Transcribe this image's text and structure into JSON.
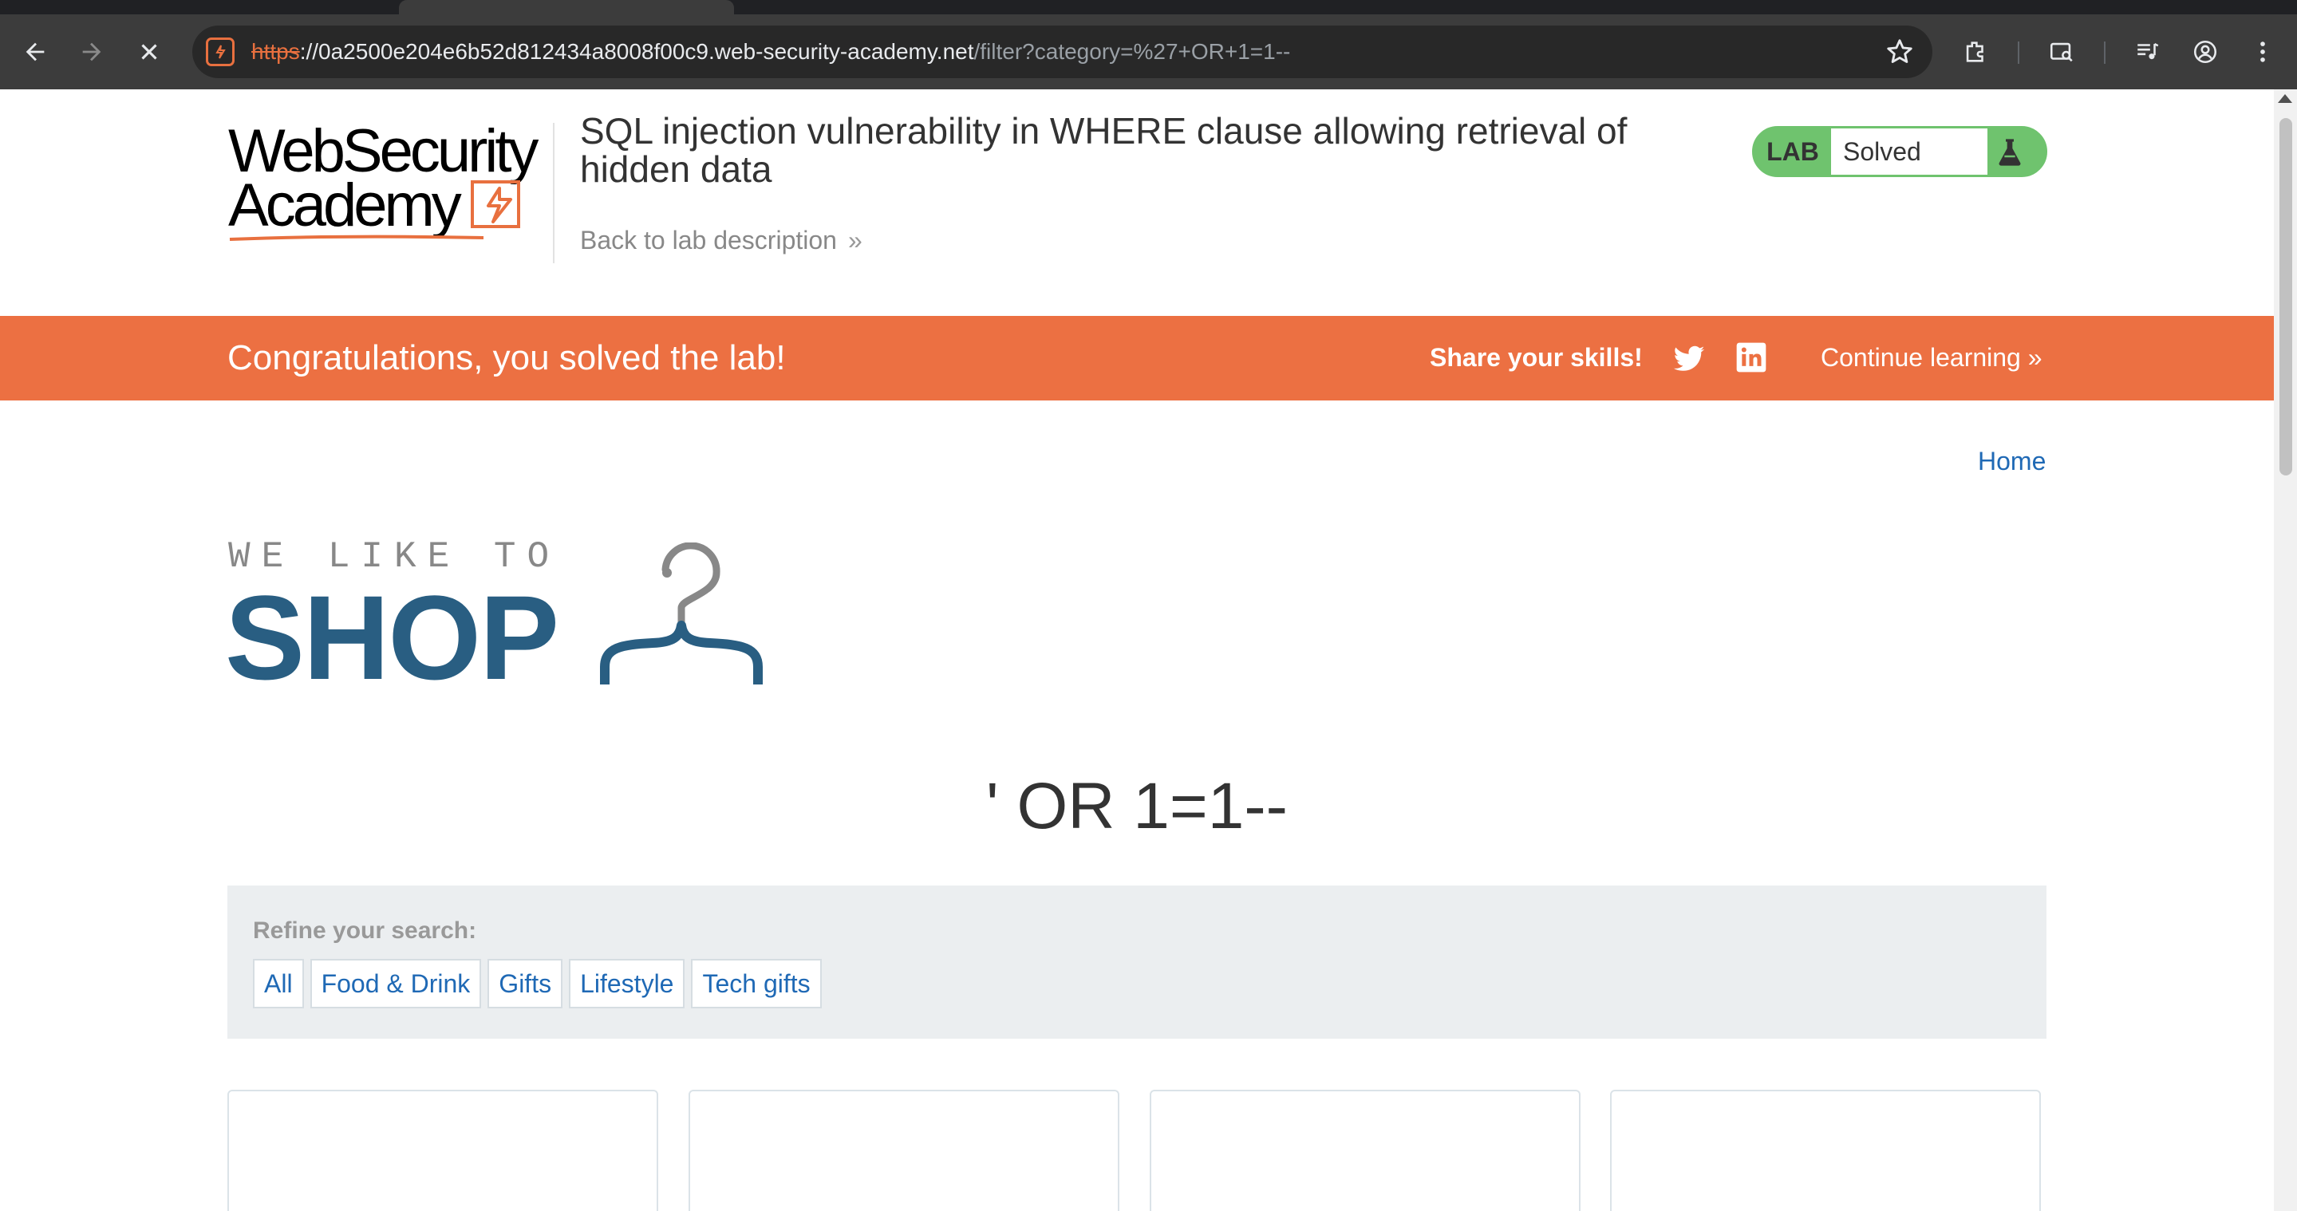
{
  "browser": {
    "url_scheme": "https",
    "url_host": "://0a2500e204e6b52d812434a8008f00c9.web-security-academy.net",
    "url_path": "/filter?category=%27+OR+1=1--",
    "icons": [
      "back-icon",
      "forward-icon",
      "stop-icon",
      "site-icon",
      "star-icon",
      "extensions-icon",
      "reading-mode-icon",
      "media-icon",
      "profile-icon",
      "menu-icon"
    ]
  },
  "lab_header": {
    "logo_line1": "WebSecurity",
    "logo_line2": "Academy",
    "title": "SQL injection vulnerability in WHERE clause allowing retrieval of hidden data",
    "back_link": "Back to lab description",
    "badge_label": "LAB",
    "badge_status": "Solved",
    "badge_color": "#6fc36e"
  },
  "banner": {
    "message": "Congratulations, you solved the lab!",
    "share_label": "Share your skills!",
    "continue_label": "Continue learning",
    "color": "#ec7042"
  },
  "shop": {
    "home_link": "Home",
    "logo_top": "WE LIKE TO",
    "logo_main": "SHOP",
    "search_term": "' OR 1=1--",
    "refine_label": "Refine your search:",
    "filters": [
      "All",
      "Food & Drink",
      "Gifts",
      "Lifestyle",
      "Tech gifts"
    ],
    "accent": "#1f69b5"
  }
}
